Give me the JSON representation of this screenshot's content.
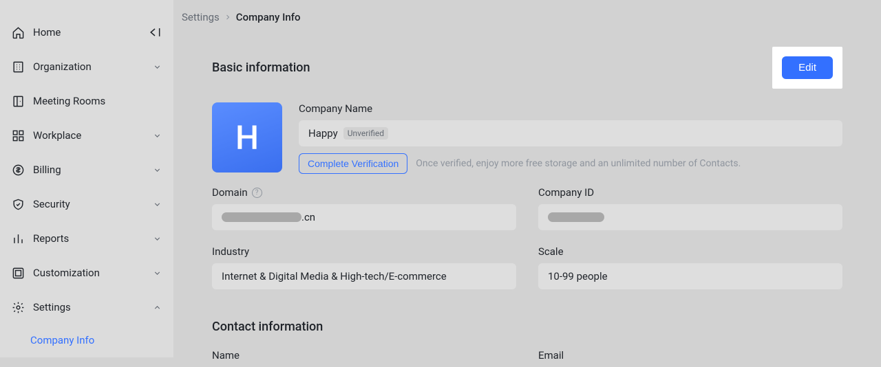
{
  "sidebar": {
    "items": [
      {
        "label": "Home",
        "icon": "home",
        "chevron": "collapse"
      },
      {
        "label": "Organization",
        "icon": "org",
        "chevron": "down"
      },
      {
        "label": "Meeting Rooms",
        "icon": "rooms",
        "chevron": null
      },
      {
        "label": "Workplace",
        "icon": "workplace",
        "chevron": "down"
      },
      {
        "label": "Billing",
        "icon": "billing",
        "chevron": "down"
      },
      {
        "label": "Security",
        "icon": "security",
        "chevron": "down"
      },
      {
        "label": "Reports",
        "icon": "reports",
        "chevron": "down"
      },
      {
        "label": "Customization",
        "icon": "customization",
        "chevron": "down"
      },
      {
        "label": "Settings",
        "icon": "settings",
        "chevron": "up"
      }
    ],
    "subitem": "Company Info"
  },
  "breadcrumb": {
    "root": "Settings",
    "current": "Company Info"
  },
  "basic": {
    "section_title": "Basic information",
    "edit_label": "Edit",
    "avatar_letter": "H",
    "company_name_label": "Company Name",
    "company_name_value": "Happy",
    "unverified_badge": "Unverified",
    "verify_btn": "Complete Verification",
    "verify_hint": "Once verified, enjoy more free storage and an unlimited number of Contacts.",
    "domain_label": "Domain",
    "domain_suffix": ".cn",
    "company_id_label": "Company ID",
    "industry_label": "Industry",
    "industry_value": "Internet & Digital Media & High-tech/E-commerce",
    "scale_label": "Scale",
    "scale_value": "10-99 people"
  },
  "contact": {
    "section_title": "Contact information",
    "name_label": "Name",
    "email_label": "Email"
  }
}
